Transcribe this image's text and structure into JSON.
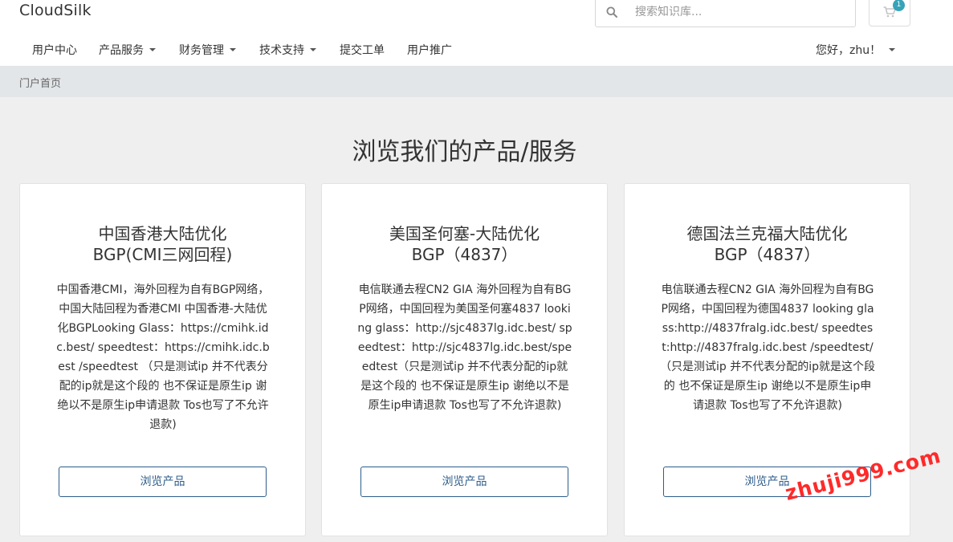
{
  "header": {
    "brand": "CloudSilk",
    "search_placeholder": "搜索知识库...",
    "cart_count": "1"
  },
  "nav": {
    "items": [
      {
        "label": "用户中心"
      },
      {
        "label": "产品服务"
      },
      {
        "label": "财务管理"
      },
      {
        "label": "技术支持"
      },
      {
        "label": "提交工单"
      },
      {
        "label": "用户推广"
      }
    ],
    "greeting": "您好，zhu！"
  },
  "breadcrumb": {
    "home": "门户首页"
  },
  "page": {
    "heading": "浏览我们的产品/服务"
  },
  "cards": [
    {
      "title_line1": "中国香港大陆优化",
      "title_line2": "BGP(CMI三网回程)",
      "description": "中国香港CMI，海外回程为自有BGP网络，中国大陆回程为香港CMI 中国香港-大陆优化BGPLooking Glass：https://cmihk.idc.best/ speedtest：https://cmihk.idc.best /speedtest （只是测试ip 并不代表分配的ip就是这个段的 也不保证是原生ip 谢绝以不是原生ip申请退款 Tos也写了不允许退款)",
      "button": "浏览产品"
    },
    {
      "title_line1": "美国圣何塞-大陆优化",
      "title_line2": "BGP（4837）",
      "description": "电信联通去程CN2 GIA 海外回程为自有BGP网络，中国回程为美国圣何塞4837 looking glass：http://sjc4837lg.idc.best/ speedtest：http://sjc4837lg.idc.best/speedtest（只是测试ip 并不代表分配的ip就是这个段的 也不保证是原生ip 谢绝以不是原生ip申请退款 Tos也写了不允许退款)",
      "button": "浏览产品"
    },
    {
      "title_line1": "德国法兰克福大陆优化",
      "title_line2": "BGP（4837）",
      "description": "电信联通去程CN2 GIA 海外回程为自有BGP网络，中国回程为德国4837 looking glass:http://4837fralg.idc.best/ speedtest:http://4837fralg.idc.best /speedtest/ （只是测试ip 并不代表分配的ip就是这个段的 也不保证是原生ip 谢绝以不是原生ip申请退款 Tos也写了不允许退款)",
      "button": "浏览产品"
    }
  ],
  "watermark": "zhuji999.com"
}
